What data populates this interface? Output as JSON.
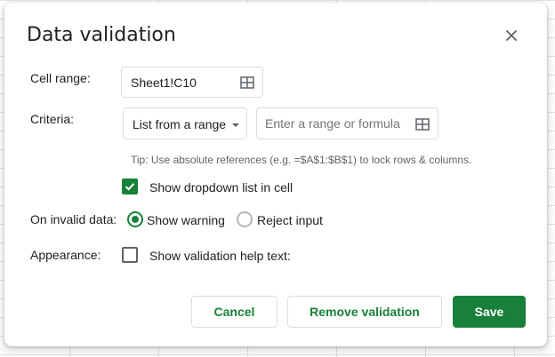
{
  "dialog": {
    "title": "Data validation",
    "close_icon": "close-icon"
  },
  "cell_range": {
    "label": "Cell range:",
    "value": "Sheet1!C10",
    "icon": "grid-select-icon"
  },
  "criteria": {
    "label": "Criteria:",
    "type_selected": "List from a range",
    "range_placeholder": "Enter a range or formula",
    "range_value": "",
    "icon": "grid-select-icon"
  },
  "tip": "Tip: Use absolute references (e.g. =$A$1:$B$1) to lock rows & columns.",
  "show_dropdown": {
    "label": "Show dropdown list in cell",
    "checked": true
  },
  "invalid_data": {
    "label": "On invalid data:",
    "options": [
      {
        "label": "Show warning",
        "selected": true
      },
      {
        "label": "Reject input",
        "selected": false
      }
    ]
  },
  "appearance": {
    "label": "Appearance:",
    "help_text_label": "Show validation help text:",
    "checked": false
  },
  "buttons": {
    "cancel": "Cancel",
    "remove": "Remove validation",
    "save": "Save"
  },
  "colors": {
    "accent": "#188038",
    "border": "#dadce0",
    "text": "#202124",
    "muted_text": "#5f6368"
  }
}
